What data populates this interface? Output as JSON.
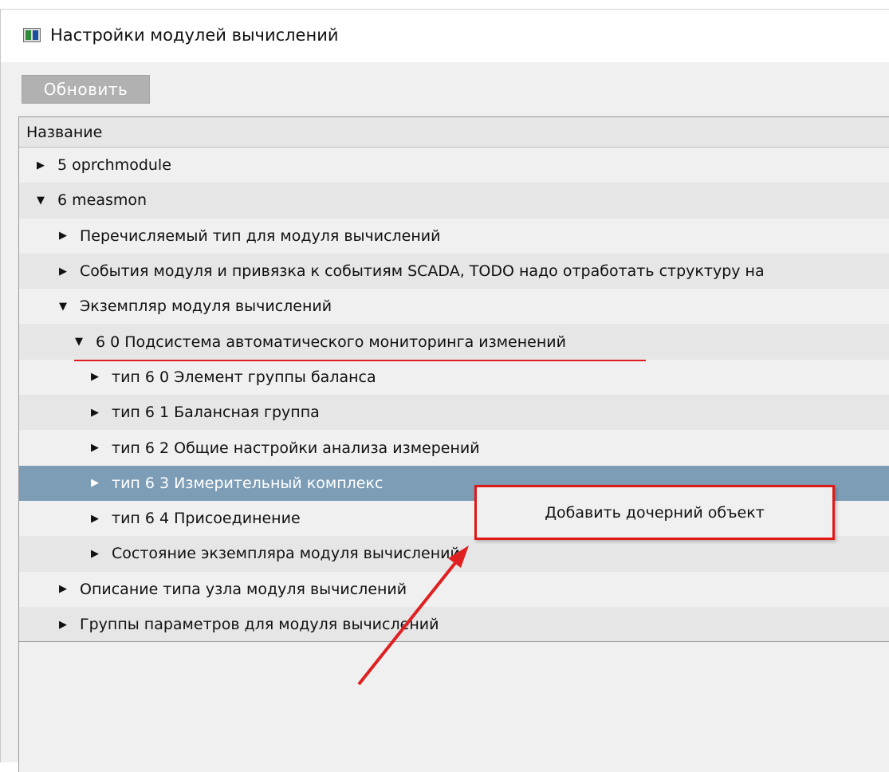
{
  "window": {
    "title": "Настройки модулей вычислений"
  },
  "toolbar": {
    "refresh_label": "Обновить"
  },
  "tree": {
    "column_header": "Название",
    "rows": [
      {
        "label": "5 oprchmodule",
        "level": 0,
        "expanded": false,
        "style": "plain"
      },
      {
        "label": "6 measmon",
        "level": 0,
        "expanded": true,
        "style": "alt"
      },
      {
        "label": "Перечисляемый тип для модуля вычислений",
        "level": 1,
        "expanded": false,
        "style": "plain"
      },
      {
        "label": "События модуля и привязка к событиям SCADA, TODO надо отработать структуру на",
        "level": 1,
        "expanded": false,
        "style": "alt"
      },
      {
        "label": "Экземпляр модуля вычислений",
        "level": 1,
        "expanded": true,
        "style": "plain"
      },
      {
        "label": "6 0 Подсистема автоматического мониторинга изменений",
        "level": 2,
        "expanded": true,
        "style": "alt"
      },
      {
        "label": "тип 6 0 Элемент группы баланса",
        "level": 3,
        "expanded": false,
        "style": "plain"
      },
      {
        "label": "тип 6 1 Балансная группа",
        "level": 3,
        "expanded": false,
        "style": "alt"
      },
      {
        "label": "тип 6 2 Общие настройки анализа измерений",
        "level": 3,
        "expanded": false,
        "style": "plain"
      },
      {
        "label": "тип 6 3 Измерительный комплекс",
        "level": 3,
        "expanded": false,
        "style": "selected"
      },
      {
        "label": "тип 6 4 Присоединение",
        "level": 3,
        "expanded": false,
        "style": "plain"
      },
      {
        "label": "Состояние экземпляра модуля вычислений",
        "level": 3,
        "expanded": false,
        "style": "alt"
      },
      {
        "label": "Описание типа узла модуля вычислений",
        "level": 1,
        "expanded": false,
        "style": "plain"
      },
      {
        "label": "Группы параметров для модуля вычислений",
        "level": 1,
        "expanded": false,
        "style": "alt"
      }
    ]
  },
  "context_menu": {
    "item_label": "Добавить дочерний объект"
  },
  "icons": {
    "collapsed": "triangle-right-icon",
    "expanded": "triangle-down-icon",
    "app": "window-app-icon"
  },
  "colors": {
    "selection": "#7d9db6",
    "annotation": "#e02020"
  }
}
